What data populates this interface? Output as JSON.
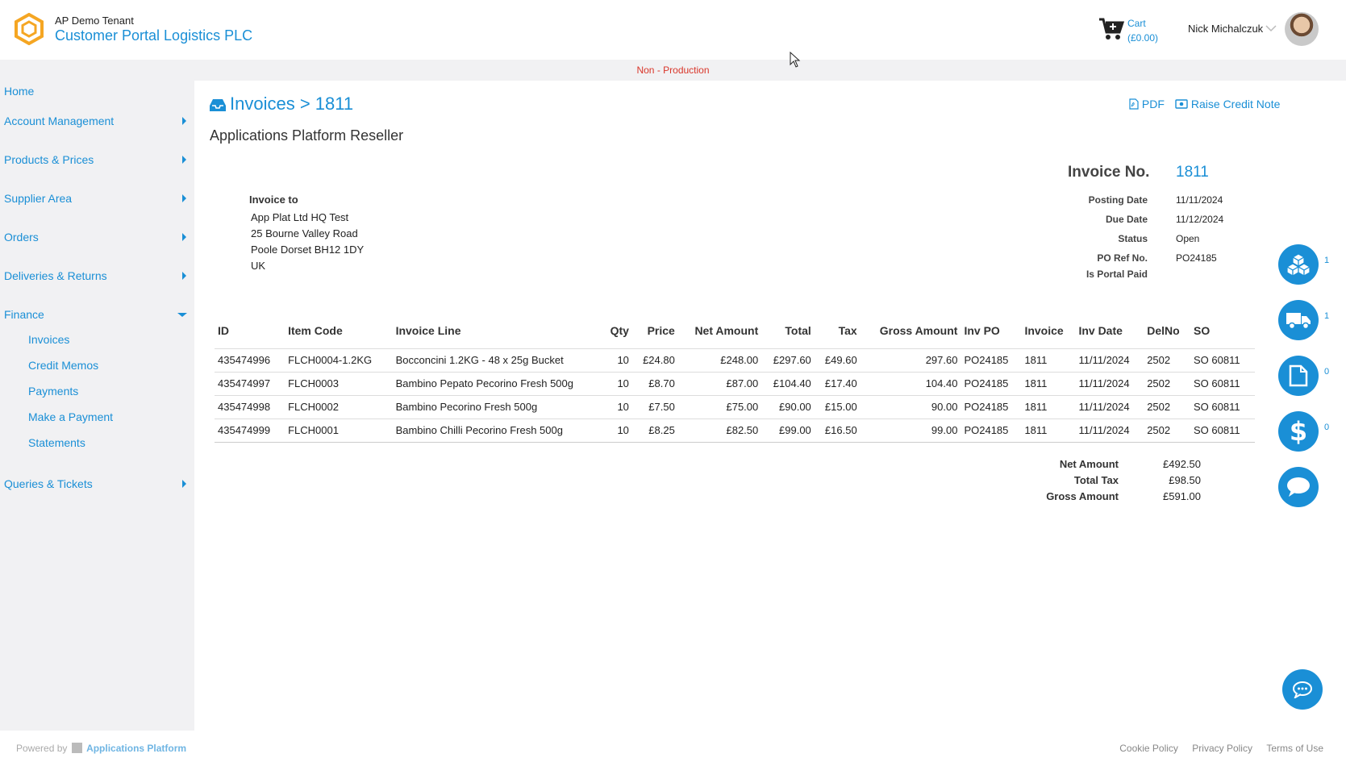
{
  "header": {
    "tenant": "AP Demo Tenant",
    "company": "Customer Portal Logistics PLC",
    "cart_label": "Cart",
    "cart_total": "(£0.00)",
    "user_name": "Nick Michalczuk",
    "environment": "Non - Production"
  },
  "sidebar": {
    "items": [
      {
        "label": "Home"
      },
      {
        "label": "Account Management"
      },
      {
        "label": "Products & Prices"
      },
      {
        "label": "Supplier Area"
      },
      {
        "label": "Orders"
      },
      {
        "label": "Deliveries & Returns"
      },
      {
        "label": "Finance"
      },
      {
        "label": "Queries & Tickets"
      }
    ],
    "finance_sub": [
      {
        "label": "Invoices"
      },
      {
        "label": "Credit Memos"
      },
      {
        "label": "Payments"
      },
      {
        "label": "Make a Payment"
      },
      {
        "label": "Statements"
      }
    ]
  },
  "page": {
    "title": "Invoices > 1811",
    "subtitle": "Applications Platform Reseller",
    "pdf_label": "PDF",
    "credit_label": "Raise Credit Note"
  },
  "invoice_to": {
    "label": "Invoice to",
    "lines": [
      "App Plat Ltd HQ Test",
      "25 Bourne Valley Road",
      "Poole Dorset BH12 1DY",
      "UK"
    ]
  },
  "invoice_meta": {
    "no_label": "Invoice No.",
    "no_value": "1811",
    "posting_label": "Posting Date",
    "posting_value": "11/11/2024",
    "due_label": "Due Date",
    "due_value": "11/12/2024",
    "status_label": "Status",
    "status_value": "Open",
    "po_label": "PO Ref No.",
    "po_value": "PO24185",
    "portal_label": "Is Portal Paid"
  },
  "table": {
    "headers": [
      "ID",
      "Item Code",
      "Invoice Line",
      "Qty",
      "Price",
      "Net Amount",
      "Total",
      "Tax",
      "Gross Amount",
      "Inv PO",
      "Invoice",
      "Inv Date",
      "DelNo",
      "SO"
    ],
    "rows": [
      [
        "435474996",
        "FLCH0004-1.2KG",
        "Bocconcini 1.2KG - 48 x 25g Bucket",
        "10",
        "£24.80",
        "£248.00",
        "£297.60",
        "£49.60",
        "297.60",
        "PO24185",
        "1811",
        "11/11/2024",
        "2502",
        "SO 60811"
      ],
      [
        "435474997",
        "FLCH0003",
        "Bambino Pepato Pecorino Fresh 500g",
        "10",
        "£8.70",
        "£87.00",
        "£104.40",
        "£17.40",
        "104.40",
        "PO24185",
        "1811",
        "11/11/2024",
        "2502",
        "SO 60811"
      ],
      [
        "435474998",
        "FLCH0002",
        "Bambino Pecorino Fresh 500g",
        "10",
        "£7.50",
        "£75.00",
        "£90.00",
        "£15.00",
        "90.00",
        "PO24185",
        "1811",
        "11/11/2024",
        "2502",
        "SO 60811"
      ],
      [
        "435474999",
        "FLCH0001",
        "Bambino Chilli Pecorino Fresh 500g",
        "10",
        "£8.25",
        "£82.50",
        "£99.00",
        "£16.50",
        "99.00",
        "PO24185",
        "1811",
        "11/11/2024",
        "2502",
        "SO 60811"
      ]
    ]
  },
  "totals": {
    "net_label": "Net Amount",
    "net_value": "£492.50",
    "tax_label": "Total Tax",
    "tax_value": "£98.50",
    "gross_label": "Gross Amount",
    "gross_value": "£591.00"
  },
  "side_buttons": [
    {
      "icon": "boxes-icon",
      "count": "1"
    },
    {
      "icon": "truck-icon",
      "count": "1"
    },
    {
      "icon": "document-icon",
      "count": "0"
    },
    {
      "icon": "dollar-icon",
      "count": "0"
    },
    {
      "icon": "speech-bubble-icon",
      "count": ""
    }
  ],
  "footer": {
    "powered_by": "Powered by",
    "brand": "Applications Platform",
    "links": [
      "Cookie Policy",
      "Privacy Policy",
      "Terms of Use"
    ]
  },
  "colors": {
    "accent": "#1a8fd6",
    "logo": "#f5a623",
    "env_warning": "#d9362a"
  }
}
